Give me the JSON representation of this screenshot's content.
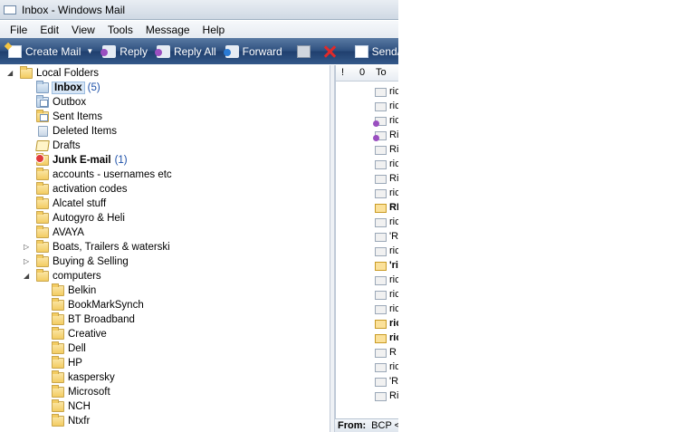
{
  "window": {
    "title": "Inbox - Windows Mail"
  },
  "menu": [
    "File",
    "Edit",
    "View",
    "Tools",
    "Message",
    "Help"
  ],
  "toolbar": {
    "create_mail": "Create Mail",
    "reply": "Reply",
    "reply_all": "Reply All",
    "forward": "Forward",
    "send_receive": "Send/Receiv"
  },
  "folders": {
    "root": "Local Folders",
    "items": [
      {
        "name": "Inbox",
        "count": "(5)"
      },
      {
        "name": "Outbox"
      },
      {
        "name": "Sent Items"
      },
      {
        "name": "Deleted Items"
      },
      {
        "name": "Drafts"
      },
      {
        "name": "Junk E-mail",
        "count": "(1)"
      },
      {
        "name": "accounts - usernames etc"
      },
      {
        "name": "activation  codes"
      },
      {
        "name": "Alcatel stuff"
      },
      {
        "name": "Autogyro &  Heli"
      },
      {
        "name": "AVAYA"
      },
      {
        "name": "Boats, Trailers & waterski"
      },
      {
        "name": "Buying & Selling"
      },
      {
        "name": "computers"
      },
      {
        "name": "Belkin"
      },
      {
        "name": "BookMarkSynch"
      },
      {
        "name": "BT Broadband"
      },
      {
        "name": "Creative"
      },
      {
        "name": "Dell"
      },
      {
        "name": "HP"
      },
      {
        "name": "kaspersky"
      },
      {
        "name": "Microsoft"
      },
      {
        "name": "NCH"
      },
      {
        "name": "Ntxfr"
      }
    ]
  },
  "message_list": {
    "columns": {
      "priority": "!",
      "attachment": "0",
      "to": "To"
    },
    "rows": [
      "ric",
      "ric",
      "ric",
      "Ri",
      "Ri",
      "ric",
      "Ri",
      "ric",
      "RI",
      "ric",
      "'Ri",
      "ric",
      "'ri",
      "ric",
      "ric",
      "ric",
      "ric",
      "ric",
      "R (",
      "ric",
      "'Ri",
      "Ri"
    ]
  },
  "preview": {
    "from_label": "From:",
    "from_value": "BCP <("
  }
}
